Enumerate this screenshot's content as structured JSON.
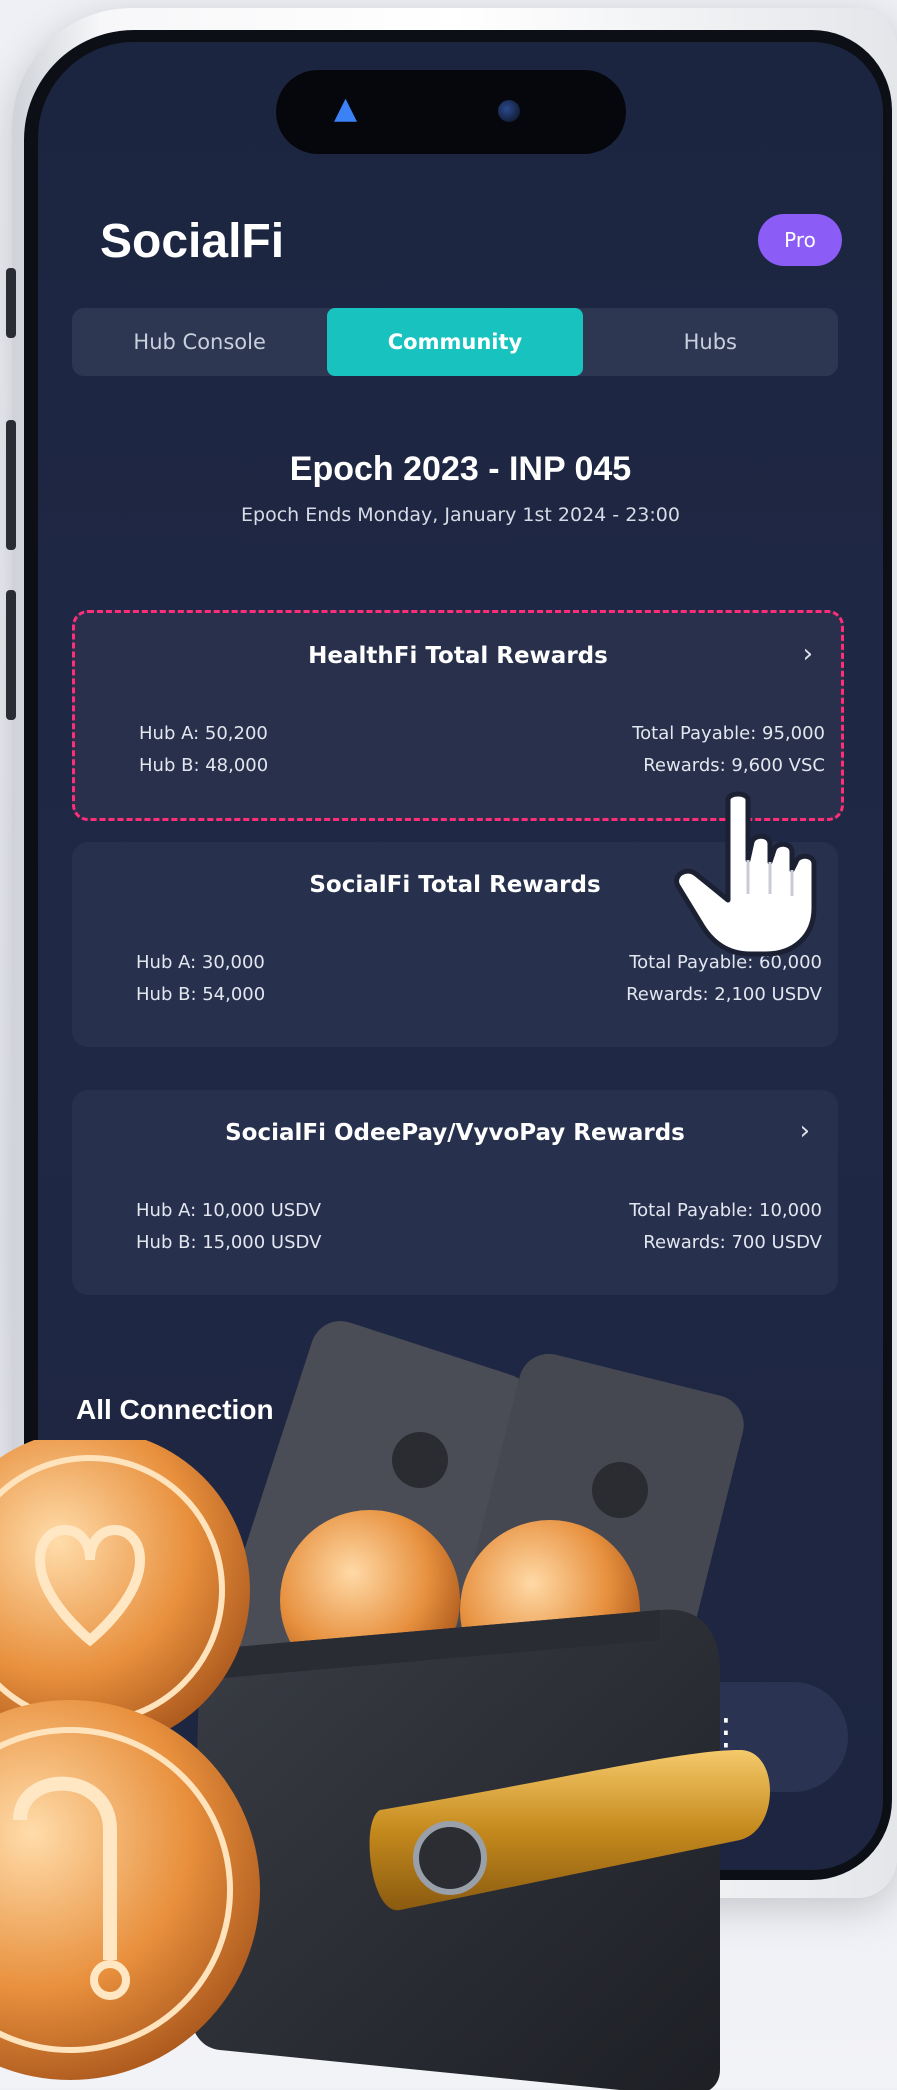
{
  "app": {
    "title": "SocialFi",
    "badge": "Pro"
  },
  "tabs": [
    {
      "label": "Hub Console",
      "active": false
    },
    {
      "label": "Community",
      "active": true
    },
    {
      "label": "Hubs",
      "active": false
    }
  ],
  "epoch": {
    "title": "Epoch 2023 - INP 045",
    "subtitle": "Epoch Ends Monday, January 1st 2024 - 23:00"
  },
  "cards": [
    {
      "title": "HealthFi Total Rewards",
      "left_lines": [
        "Hub A: 50,200",
        "Hub B: 48,000"
      ],
      "right_lines": [
        "Total Payable: 95,000",
        "Rewards: 9,600 VSC"
      ],
      "highlighted": true
    },
    {
      "title": "SocialFi Total Rewards",
      "left_lines": [
        "Hub A: 30,000",
        "Hub B: 54,000"
      ],
      "right_lines": [
        "Total Payable: 60,000",
        "Rewards: 2,100 USDV"
      ],
      "highlighted": false
    },
    {
      "title": "SocialFi OdeePay/VyvoPay Rewards",
      "left_lines": [
        "Hub A: 10,000 USDV",
        "Hub B: 15,000 USDV"
      ],
      "right_lines": [
        "Total Payable: 10,000",
        "Rewards: 700 USDV"
      ],
      "highlighted": false
    }
  ],
  "connections_heading": "All Connection",
  "icons": {
    "chevron": "chevron-right-icon",
    "pointer": "pointer-hand-icon",
    "wallet": "wallet-illustration",
    "coin": "coin-icon"
  },
  "colors": {
    "accent": "#18c3bf",
    "pro": "#8b5cf6",
    "highlight_border": "#ff2d7a",
    "screen_bg": "#1f2845",
    "card_bg": "#27304d"
  }
}
